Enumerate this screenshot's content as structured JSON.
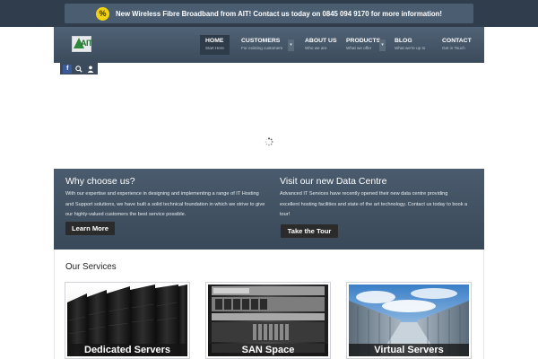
{
  "announcement": {
    "badge": "%",
    "text": "New Wireless Fibre Broadband from AIT! Contact us today on 0845 094 9170 for more information!"
  },
  "logo": {
    "text": "AIT"
  },
  "nav": [
    {
      "label": "HOME",
      "sub": "Start Here",
      "has_caret": false
    },
    {
      "label": "CUSTOMERS",
      "sub": "For existing customers",
      "has_caret": true
    },
    {
      "label": "ABOUT US",
      "sub": "Who we are",
      "has_caret": false
    },
    {
      "label": "PRODUCTS",
      "sub": "What we offer",
      "has_caret": true
    },
    {
      "label": "BLOG",
      "sub": "What we're up to",
      "has_caret": false
    },
    {
      "label": "CONTACT",
      "sub": "Get in Touch",
      "has_caret": false
    }
  ],
  "social": {
    "facebook": "f",
    "icons": [
      "facebook-icon",
      "search-icon",
      "user-icon"
    ]
  },
  "why": {
    "title": "Why choose us?",
    "text": "With our expertise and experience in designing and implementing a range of IT Hosting and Support solutions, we have built a solid technical foundation in which we strive to give our highly-valued customers the best service possible.",
    "button": "Learn More"
  },
  "datacentre": {
    "title": "Visit our new Data Centre",
    "text": "Advanced IT Services have recently opened their new data centre providing excellent hosting facilities and state of the art technology. Contact us today to book a tour!",
    "button": "Take the Tour"
  },
  "services": {
    "title": "Our Services",
    "cards": [
      {
        "label": "Dedicated Servers"
      },
      {
        "label": "SAN Space"
      },
      {
        "label": "Virtual Servers"
      }
    ]
  },
  "colors": {
    "topbar": "#2f3d4d",
    "header": "#46576a",
    "badge": "#f3d30e",
    "band": "#425364",
    "button": "#2b2b2b"
  }
}
